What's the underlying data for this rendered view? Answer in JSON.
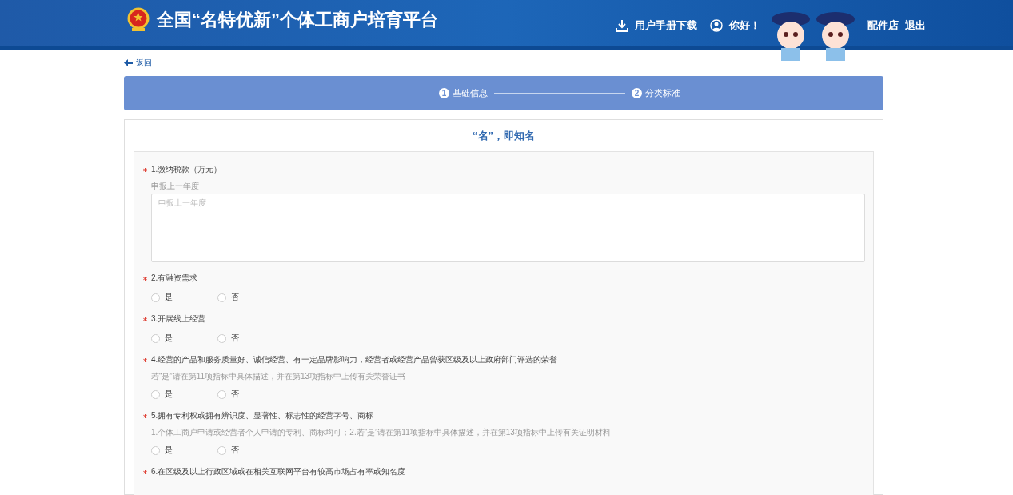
{
  "header": {
    "title": "全国“名特优新”个体工商户培育平台",
    "manual_link": "用户手册下载",
    "greeting": "你好！",
    "shop_name": "配件店",
    "logout": "退出"
  },
  "back_link": "返回",
  "steps": [
    {
      "number": "1",
      "label": "基础信息"
    },
    {
      "number": "2",
      "label": "分类标准"
    }
  ],
  "section_title": "“名”，即知名",
  "questions": [
    {
      "kind": "textarea",
      "required": true,
      "label": "1.缴纳税款（万元）",
      "hint": "申报上一年度",
      "placeholder": "申报上一年度"
    },
    {
      "kind": "radio",
      "required": true,
      "label": "2.有融资需求",
      "options": [
        {
          "label": "是",
          "selected": false
        },
        {
          "label": "否",
          "selected": false
        }
      ]
    },
    {
      "kind": "radio",
      "required": true,
      "label": "3.开展线上经营",
      "options": [
        {
          "label": "是",
          "selected": false
        },
        {
          "label": "否",
          "selected": false
        }
      ]
    },
    {
      "kind": "radio",
      "required": true,
      "label": "4.经营的产品和服务质量好、诚信经营、有一定品牌影响力，经营者或经营产品曾获区级及以上政府部门评选的荣誉",
      "hint": "若“是”请在第11项指标中具体描述，并在第13项指标中上传有关荣誉证书",
      "options": [
        {
          "label": "是",
          "selected": false
        },
        {
          "label": "否",
          "selected": false
        }
      ]
    },
    {
      "kind": "radio",
      "required": true,
      "label": "5.拥有专利权或拥有辨识度、显著性、标志性的经营字号、商标",
      "hint": "1.个体工商户申请或经营者个人申请的专利、商标均可；2.若“是”请在第11项指标中具体描述，并在第13项指标中上传有关证明材料",
      "options": [
        {
          "label": "是",
          "selected": false
        },
        {
          "label": "否",
          "selected": false
        }
      ]
    },
    {
      "kind": "label",
      "required": true,
      "label": "6.在区级及以上行政区域或在相关互联网平台有较高市场占有率或知名度"
    }
  ]
}
